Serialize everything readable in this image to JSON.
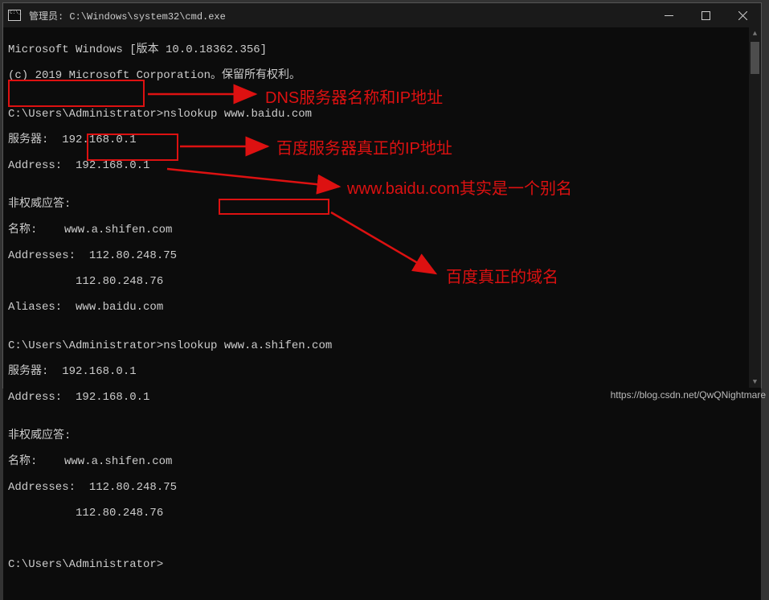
{
  "titlebar": {
    "title": "管理员: C:\\Windows\\system32\\cmd.exe"
  },
  "terminal": {
    "l1": "Microsoft Windows [版本 10.0.18362.356]",
    "l2": "(c) 2019 Microsoft Corporation。保留所有权利。",
    "l3": "",
    "l4": "C:\\Users\\Administrator>nslookup www.baidu.com",
    "l5": "服务器:  192.168.0.1",
    "l6": "Address:  192.168.0.1",
    "l7": "",
    "l8": "非权威应答:",
    "l9": "名称:    www.a.shifen.com",
    "l10": "Addresses:  112.80.248.75",
    "l11": "          112.80.248.76",
    "l12": "Aliases:  www.baidu.com",
    "l13": "",
    "l14": "C:\\Users\\Administrator>nslookup www.a.shifen.com",
    "l15": "服务器:  192.168.0.1",
    "l16": "Address:  192.168.0.1",
    "l17": "",
    "l18": "非权威应答:",
    "l19": "名称:    www.a.shifen.com",
    "l20": "Addresses:  112.80.248.75",
    "l21": "          112.80.248.76",
    "l22": "",
    "l23": "",
    "l24": "C:\\Users\\Administrator>"
  },
  "annotations": {
    "a1": "DNS服务器名称和IP地址",
    "a2": "百度服务器真正的IP地址",
    "a3": "www.baidu.com其实是一个别名",
    "a4": "百度真正的域名"
  },
  "watermark": "https://blog.csdn.net/QwQNightmare"
}
